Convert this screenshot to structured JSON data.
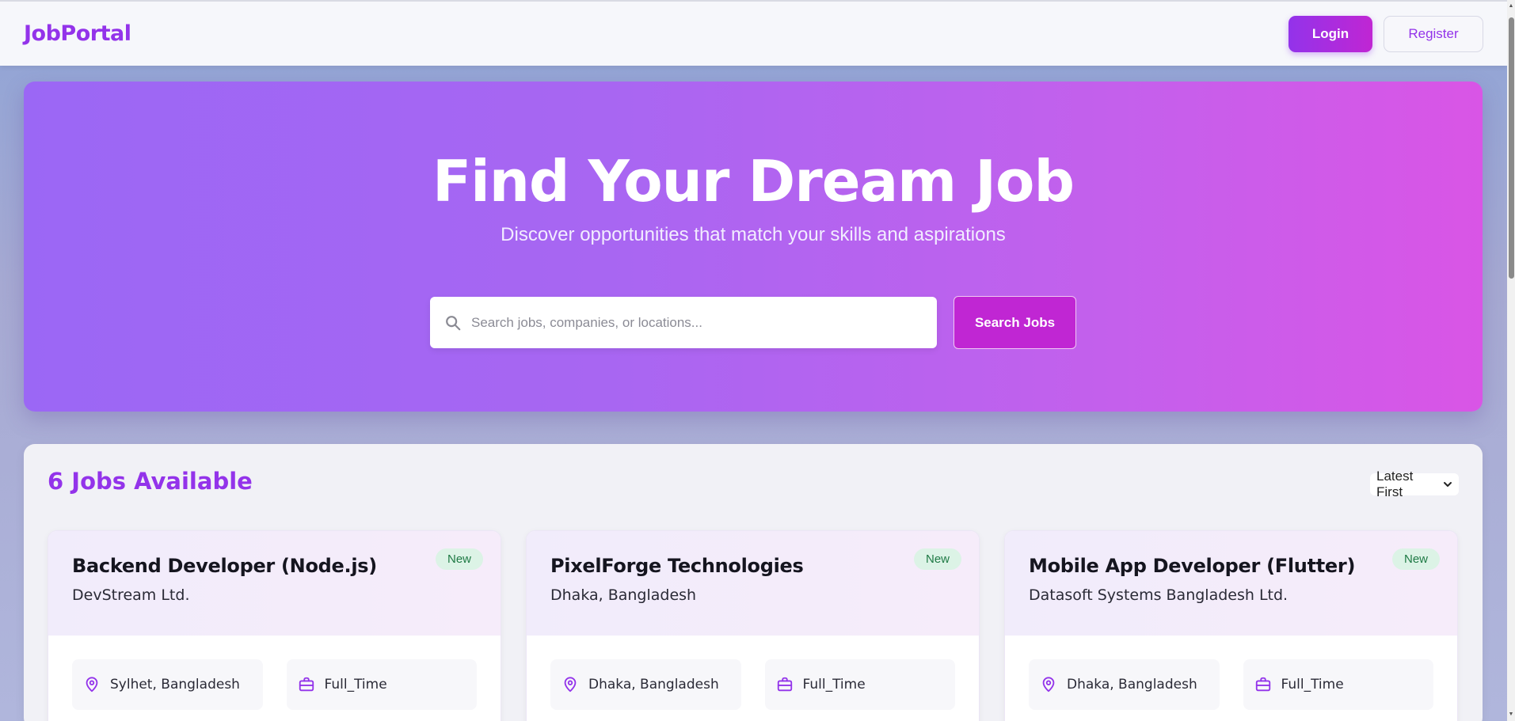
{
  "navbar": {
    "brand": "JobPortal",
    "login_label": "Login",
    "register_label": "Register"
  },
  "hero": {
    "title": "Find Your Dream Job",
    "subtitle": "Discover opportunities that match your skills and aspirations",
    "search_placeholder": "Search jobs, companies, or locations...",
    "search_button": "Search Jobs"
  },
  "jobs": {
    "count_label": "6 Jobs Available",
    "sort_value": "Latest First",
    "cards": [
      {
        "title": "Backend Developer (Node.js)",
        "company": "DevStream Ltd.",
        "badge": "New",
        "location": "Sylhet, Bangladesh",
        "type": "Full_Time"
      },
      {
        "title": "PixelForge Technologies",
        "company": "Dhaka, Bangladesh",
        "badge": "New",
        "location": "Dhaka, Bangladesh",
        "type": "Full_Time"
      },
      {
        "title": "Mobile App Developer (Flutter)",
        "company": "Datasoft Systems Bangladesh Ltd.",
        "badge": "New",
        "location": "Dhaka, Bangladesh",
        "type": "Full_Time"
      }
    ]
  },
  "colors": {
    "brand": "#9333ea",
    "accent": "#c026d3",
    "badge_bg": "#dcf3e6",
    "badge_text": "#1f7a45"
  },
  "icons": {
    "search": "search-icon",
    "location": "map-pin-icon",
    "job_type": "briefcase-icon",
    "sort": "chevron-down-icon"
  }
}
